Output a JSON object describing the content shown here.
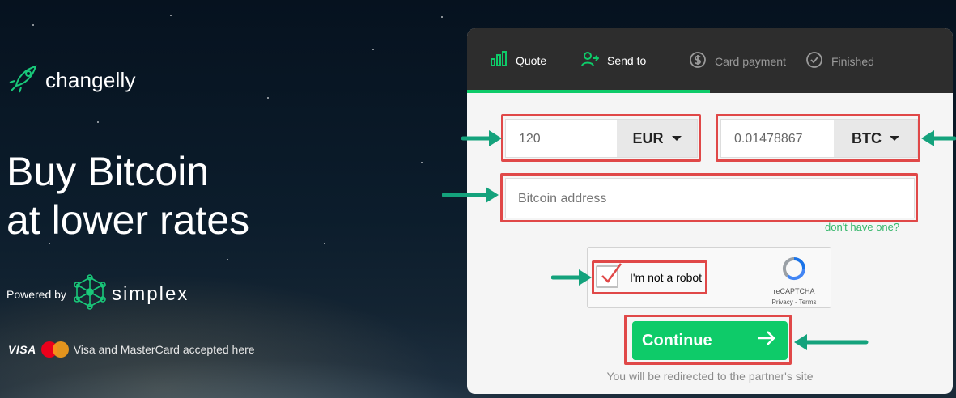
{
  "brand": {
    "name": "changelly"
  },
  "hero": {
    "line1": "Buy Bitcoin",
    "line2": "at lower rates"
  },
  "powered": {
    "label": "Powered by",
    "partner": "simplex"
  },
  "cards": {
    "visa": "VISA",
    "text": "Visa and MasterCard accepted here"
  },
  "tabs": [
    {
      "label": "Quote",
      "icon": "bar-chart-icon",
      "active": true
    },
    {
      "label": "Send to",
      "icon": "user-arrow-icon",
      "active": true
    },
    {
      "label": "Card payment",
      "icon": "dollar-circle-icon",
      "active": false
    },
    {
      "label": "Finished",
      "icon": "check-circle-icon",
      "active": false
    }
  ],
  "progress_fraction": 0.5,
  "form": {
    "amount_value": "120",
    "amount_currency": "EUR",
    "receive_value": "0.01478867",
    "receive_currency": "BTC",
    "address_placeholder": "Bitcoin address",
    "no_address_link": "don't have one?"
  },
  "captcha": {
    "label": "I'm not a robot",
    "brand": "reCAPTCHA",
    "links": "Privacy - Terms"
  },
  "continue_label": "Continue",
  "redirect_note": "You will be redirected to the partner's site",
  "colors": {
    "accent": "#0ecb69",
    "highlight": "#e04848",
    "arrow": "#14a27c",
    "tabbar": "#2d2d2d"
  }
}
